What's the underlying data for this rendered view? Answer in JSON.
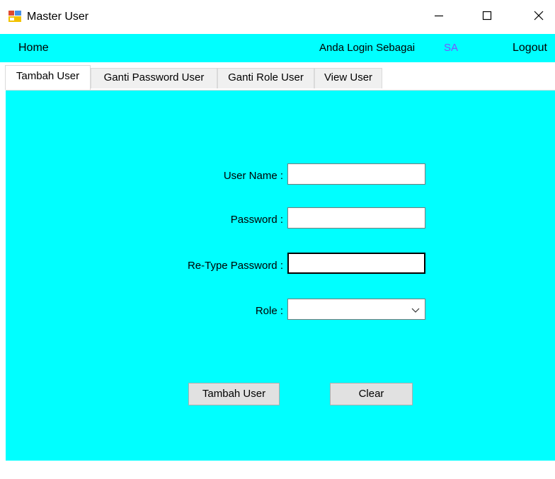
{
  "window": {
    "title": "Master User",
    "icon": "form-app-icon",
    "controls": {
      "minimize_icon": "minimize-icon",
      "maximize_icon": "maximize-icon",
      "close_icon": "close-icon"
    }
  },
  "menu": {
    "home": "Home",
    "login_as_label": "Anda Login Sebagai",
    "login_user": "SA",
    "logout": "Logout"
  },
  "tabs": [
    {
      "label": "Tambah User",
      "active": true
    },
    {
      "label": "Ganti Password User",
      "active": false
    },
    {
      "label": "Ganti Role User",
      "active": false
    },
    {
      "label": "View User",
      "active": false
    }
  ],
  "form": {
    "username_label": "User Name :",
    "username_value": "",
    "password_label": "Password :",
    "password_value": "",
    "retype_label": "Re-Type Password :",
    "retype_value": "",
    "role_label": "Role :",
    "role_value": ""
  },
  "buttons": {
    "tambah": "Tambah User",
    "clear": "Clear"
  },
  "colors": {
    "accent_background": "#00ffff",
    "logged_user_text": "#7a52ff",
    "button_face": "#e1e1e1"
  }
}
